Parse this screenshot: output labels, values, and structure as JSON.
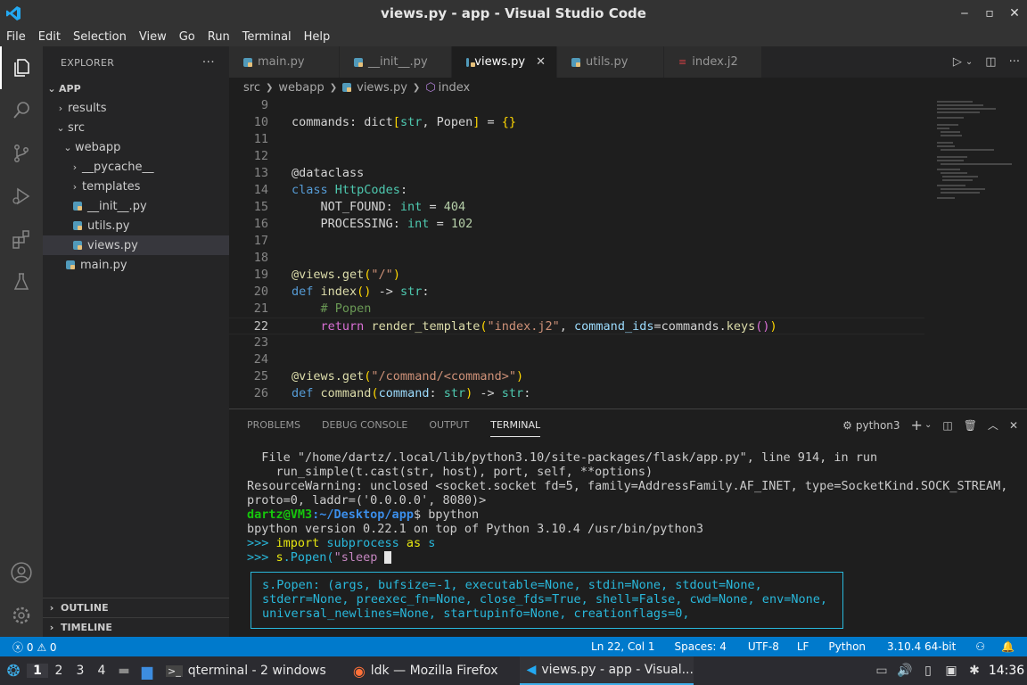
{
  "window": {
    "title": "views.py - app - Visual Studio Code"
  },
  "menu": [
    "File",
    "Edit",
    "Selection",
    "View",
    "Go",
    "Run",
    "Terminal",
    "Help"
  ],
  "explorer": {
    "header": "EXPLORER",
    "more": "···",
    "root": "APP",
    "items": [
      {
        "label": "results",
        "type": "folder",
        "open": false
      },
      {
        "label": "src",
        "type": "folder",
        "open": true
      },
      {
        "label": "webapp",
        "type": "folder",
        "open": true
      },
      {
        "label": "__pycache__",
        "type": "folder",
        "open": false
      },
      {
        "label": "templates",
        "type": "folder",
        "open": false
      },
      {
        "label": "__init__.py",
        "type": "py"
      },
      {
        "label": "utils.py",
        "type": "py"
      },
      {
        "label": "views.py",
        "type": "py",
        "selected": true
      },
      {
        "label": "main.py",
        "type": "py"
      }
    ],
    "outline": "OUTLINE",
    "timeline": "TIMELINE"
  },
  "tabs": [
    {
      "label": "main.py",
      "active": false
    },
    {
      "label": "__init__.py",
      "active": false
    },
    {
      "label": "views.py",
      "active": true
    },
    {
      "label": "utils.py",
      "active": false
    },
    {
      "label": "index.j2",
      "active": false
    }
  ],
  "breadcrumb": [
    "src",
    "webapp",
    "views.py",
    "index"
  ],
  "code": {
    "line_numbers": [
      "9",
      "10",
      "11",
      "12",
      "13",
      "14",
      "15",
      "16",
      "17",
      "18",
      "19",
      "20",
      "21",
      "22",
      "23",
      "24",
      "25",
      "26"
    ],
    "current_line": "22"
  },
  "panel": {
    "tabs": [
      "PROBLEMS",
      "DEBUG CONSOLE",
      "OUTPUT",
      "TERMINAL"
    ],
    "active_tab": "TERMINAL",
    "shell": "python3",
    "terminal_lines": [
      "  File \"/home/dartz/.local/lib/python3.10/site-packages/flask/app.py\", line 914, in run",
      "    run_simple(t.cast(str, host), port, self, **options)",
      "ResourceWarning: unclosed <socket.socket fd=5, family=AddressFamily.AF_INET, type=SocketKind.SOCK_STREAM,",
      "proto=0, laddr=('0.0.0.0', 8080)>"
    ],
    "prompt_user": "dartz@VM3",
    "prompt_path": ":~/Desktop/app",
    "prompt_cmd": "$ bpython",
    "bpython_version": "bpython version 0.22.1 on top of Python 3.10.4 /usr/bin/python3",
    "repl_prompt": ">>> ",
    "repl_line1_kw": "import",
    "repl_line1_mod": " subprocess ",
    "repl_line1_as": "as",
    "repl_line1_alias": " s",
    "repl_line2_obj": "s",
    "repl_line2_call": ".Popen(",
    "repl_line2_str": "\"sleep ",
    "suggestion": [
      "s.Popen: (args, bufsize=-1, executable=None, stdin=None, stdout=None,",
      "stderr=None, preexec_fn=None, close_fds=True, shell=False, cwd=None, env=None,",
      "universal_newlines=None, startupinfo=None, creationflags=0,"
    ]
  },
  "status": {
    "errors": "0",
    "warnings": "0",
    "position": "Ln 22, Col 1",
    "spaces": "Spaces: 4",
    "encoding": "UTF-8",
    "eol": "LF",
    "language": "Python",
    "interpreter": "3.10.4 64-bit"
  },
  "taskbar": {
    "workspaces": [
      "1",
      "2",
      "3",
      "4"
    ],
    "tasks": [
      {
        "label": "qterminal - 2 windows",
        "icon": "terminal-icon",
        "active": false
      },
      {
        "label": "ldk — Mozilla Firefox",
        "icon": "firefox-icon",
        "active": false
      },
      {
        "label": "views.py - app - Visual...",
        "icon": "vscode-icon",
        "active": true
      }
    ],
    "clock": "14:36"
  }
}
